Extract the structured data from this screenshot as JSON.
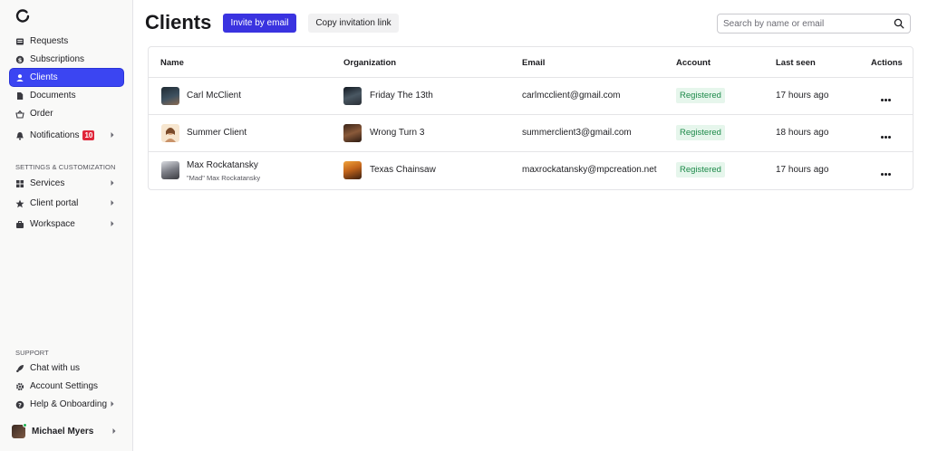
{
  "sidebar": {
    "nav": [
      {
        "label": "Requests",
        "icon": "inbox-icon"
      },
      {
        "label": "Subscriptions",
        "icon": "dollar-icon"
      },
      {
        "label": "Clients",
        "icon": "user-icon",
        "active": true
      },
      {
        "label": "Documents",
        "icon": "document-icon"
      },
      {
        "label": "Order",
        "icon": "basket-icon"
      },
      {
        "label": "Notifications",
        "icon": "bell-icon",
        "badge": "10"
      }
    ],
    "settings_label": "SETTINGS & CUSTOMIZATION",
    "settings": [
      {
        "label": "Services",
        "icon": "grid-icon"
      },
      {
        "label": "Client portal",
        "icon": "star-icon"
      },
      {
        "label": "Workspace",
        "icon": "briefcase-icon"
      }
    ],
    "support_label": "SUPPORT",
    "support": [
      {
        "label": "Chat with us",
        "icon": "rocket-icon"
      },
      {
        "label": "Account Settings",
        "icon": "gear-icon"
      },
      {
        "label": "Help & Onboarding",
        "icon": "help-icon"
      }
    ],
    "user": {
      "name": "Michael Myers"
    }
  },
  "header": {
    "title": "Clients",
    "invite_label": "Invite by email",
    "copy_label": "Copy invitation link",
    "search_placeholder": "Search by name or email"
  },
  "table": {
    "columns": [
      "Name",
      "Organization",
      "Email",
      "Account",
      "Last seen",
      "Actions"
    ],
    "rows": [
      {
        "name": "Carl McClient",
        "subtitle": "",
        "organization": "Friday The 13th",
        "email": "carlmcclient@gmail.com",
        "account": "Registered",
        "last_seen": "17 hours ago"
      },
      {
        "name": "Summer Client",
        "subtitle": "",
        "organization": "Wrong Turn 3",
        "email": "summerclient3@gmail.com",
        "account": "Registered",
        "last_seen": "18 hours ago"
      },
      {
        "name": "Max Rockatansky",
        "subtitle": "\"Mad\" Max Rockatansky",
        "organization": "Texas Chainsaw",
        "email": "maxrockatansky@mpcreation.net",
        "account": "Registered",
        "last_seen": "17 hours ago"
      }
    ]
  },
  "colors": {
    "accent": "#3a33e0",
    "active_nav": "#3b45f2",
    "status_text": "#1d8a4a",
    "status_bg": "#e6f6ec",
    "badge": "#e0263a"
  }
}
